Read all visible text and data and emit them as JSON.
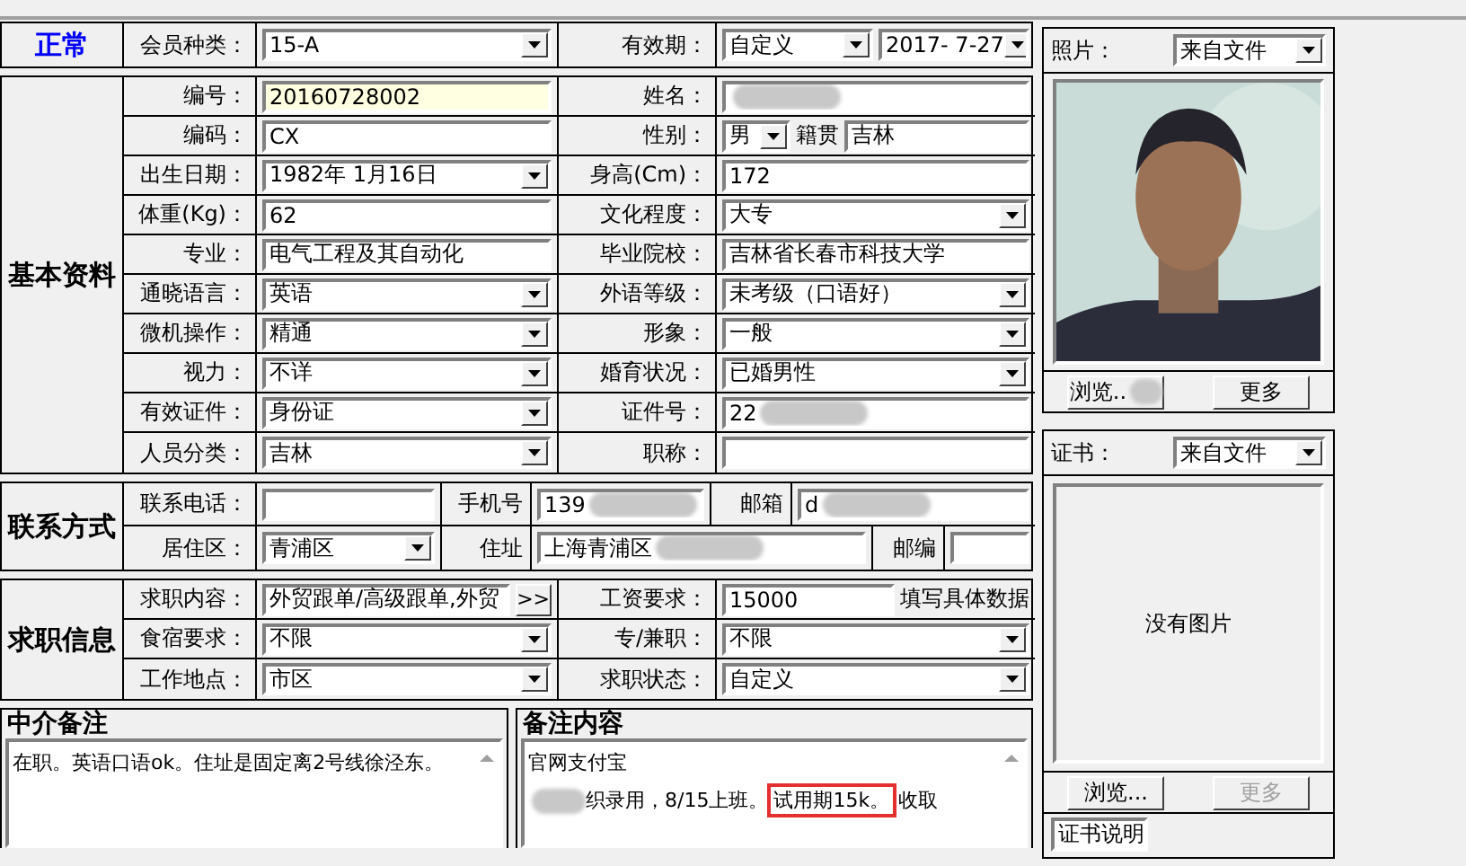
{
  "sections": [
    {
      "kind": "status",
      "title": "正常",
      "rows": [
        {
          "cells": [
            {
              "kind": "label",
              "text": "会员种类："
            },
            {
              "kind": "group",
              "controls": [
                {
                  "kind": "select",
                  "value": "15-A"
                }
              ]
            },
            {
              "kind": "label",
              "text": "有效期："
            },
            {
              "kind": "group",
              "controls": [
                {
                  "kind": "select",
                  "value": "自定义"
                },
                {
                  "kind": "select",
                  "value": "2017- 7-27"
                }
              ]
            }
          ]
        }
      ]
    },
    {
      "kind": "form",
      "title": "基本资料",
      "rows": [
        {
          "cells": [
            {
              "kind": "label",
              "text": "编号："
            },
            {
              "kind": "group",
              "controls": [
                {
                  "kind": "input",
                  "value": "20160728002",
                  "highlighted": true
                }
              ]
            },
            {
              "kind": "label",
              "text": "姓名："
            },
            {
              "kind": "group",
              "controls": [
                {
                  "kind": "input",
                  "highlighted": false,
                  "blurred": true
                }
              ]
            }
          ]
        },
        {
          "cells": [
            {
              "kind": "label",
              "text": "编码："
            },
            {
              "kind": "group",
              "controls": [
                {
                  "kind": "input",
                  "value": "CX",
                  "highlighted": false
                }
              ]
            },
            {
              "kind": "label",
              "text": "性别："
            },
            {
              "kind": "group",
              "controls": [
                {
                  "kind": "select",
                  "value": "男"
                },
                {
                  "kind": "text",
                  "value": "籍贯"
                },
                {
                  "kind": "input",
                  "value": "吉林",
                  "highlighted": false
                }
              ]
            }
          ]
        },
        {
          "cells": [
            {
              "kind": "label",
              "text": "出生日期："
            },
            {
              "kind": "group",
              "controls": [
                {
                  "kind": "select",
                  "value": "1982年 1月16日"
                }
              ]
            },
            {
              "kind": "label",
              "text": "身高(Cm)："
            },
            {
              "kind": "group",
              "controls": [
                {
                  "kind": "input",
                  "value": "172",
                  "highlighted": false
                }
              ]
            }
          ]
        },
        {
          "cells": [
            {
              "kind": "label",
              "text": "体重(Kg)："
            },
            {
              "kind": "group",
              "controls": [
                {
                  "kind": "input",
                  "value": "62",
                  "highlighted": false
                }
              ]
            },
            {
              "kind": "label",
              "text": "文化程度："
            },
            {
              "kind": "group",
              "controls": [
                {
                  "kind": "select",
                  "value": "大专"
                }
              ]
            }
          ]
        },
        {
          "cells": [
            {
              "kind": "label",
              "text": "专业："
            },
            {
              "kind": "group",
              "controls": [
                {
                  "kind": "input",
                  "value": "电气工程及其自动化",
                  "highlighted": false
                }
              ]
            },
            {
              "kind": "label",
              "text": "毕业院校："
            },
            {
              "kind": "group",
              "controls": [
                {
                  "kind": "input",
                  "value": "吉林省长春市科技大学",
                  "highlighted": false
                }
              ]
            }
          ]
        },
        {
          "cells": [
            {
              "kind": "label",
              "text": "通晓语言："
            },
            {
              "kind": "group",
              "controls": [
                {
                  "kind": "select",
                  "value": "英语"
                }
              ]
            },
            {
              "kind": "label",
              "text": "外语等级："
            },
            {
              "kind": "group",
              "controls": [
                {
                  "kind": "select",
                  "value": "未考级（口语好）"
                }
              ]
            }
          ]
        },
        {
          "cells": [
            {
              "kind": "label",
              "text": "微机操作："
            },
            {
              "kind": "group",
              "controls": [
                {
                  "kind": "select",
                  "value": "精通"
                }
              ]
            },
            {
              "kind": "label",
              "text": "形象："
            },
            {
              "kind": "group",
              "controls": [
                {
                  "kind": "select",
                  "value": "一般"
                }
              ]
            }
          ]
        },
        {
          "cells": [
            {
              "kind": "label",
              "text": "视力："
            },
            {
              "kind": "group",
              "controls": [
                {
                  "kind": "select",
                  "value": "不详"
                }
              ]
            },
            {
              "kind": "label",
              "text": "婚育状况："
            },
            {
              "kind": "group",
              "controls": [
                {
                  "kind": "select",
                  "value": "已婚男性"
                }
              ]
            }
          ]
        },
        {
          "cells": [
            {
              "kind": "label",
              "text": "有效证件："
            },
            {
              "kind": "group",
              "controls": [
                {
                  "kind": "select",
                  "value": "身份证"
                }
              ]
            },
            {
              "kind": "label",
              "text": "证件号："
            },
            {
              "kind": "group",
              "controls": [
                {
                  "kind": "input",
                  "value": "22",
                  "highlighted": false,
                  "blurred": true
                }
              ]
            }
          ]
        },
        {
          "cells": [
            {
              "kind": "label",
              "text": "人员分类："
            },
            {
              "kind": "group",
              "controls": [
                {
                  "kind": "select",
                  "value": "吉林"
                }
              ]
            },
            {
              "kind": "label",
              "text": "职称："
            },
            {
              "kind": "group",
              "controls": [
                {
                  "kind": "input",
                  "highlighted": false
                }
              ]
            }
          ]
        }
      ]
    },
    {
      "kind": "contact",
      "title": "联系方式",
      "rows": [
        {
          "cells": [
            {
              "kind": "label",
              "text": "联系电话："
            },
            {
              "kind": "group",
              "controls": [
                {
                  "kind": "input",
                  "highlighted": false
                }
              ]
            },
            {
              "kind": "label",
              "text": "手机号"
            },
            {
              "kind": "group",
              "controls": [
                {
                  "kind": "input",
                  "value": "139",
                  "highlighted": false,
                  "blurred": true
                }
              ]
            },
            {
              "kind": "label",
              "text": "邮箱"
            },
            {
              "kind": "group",
              "controls": [
                {
                  "kind": "input",
                  "value": "d",
                  "highlighted": false,
                  "blurred": true
                }
              ]
            }
          ]
        },
        {
          "cells": [
            {
              "kind": "label",
              "text": "居住区："
            },
            {
              "kind": "group",
              "controls": [
                {
                  "kind": "select",
                  "value": "青浦区"
                }
              ]
            },
            {
              "kind": "label",
              "text": "住址"
            },
            {
              "kind": "group",
              "controls": [
                {
                  "kind": "input",
                  "value": "上海青浦区",
                  "highlighted": false,
                  "blurred": true
                }
              ]
            },
            {
              "kind": "label",
              "text": "邮编"
            },
            {
              "kind": "group",
              "controls": [
                {
                  "kind": "input",
                  "highlighted": false
                }
              ]
            }
          ]
        }
      ]
    },
    {
      "kind": "form",
      "title": "求职信息",
      "rows": [
        {
          "cells": [
            {
              "kind": "label",
              "text": "求职内容："
            },
            {
              "kind": "group",
              "controls": [
                {
                  "kind": "input",
                  "value": "外贸跟单/高级跟单,外贸",
                  "highlighted": false
                },
                {
                  "kind": "button",
                  "value": ">>"
                }
              ]
            },
            {
              "kind": "label",
              "text": "工资要求："
            },
            {
              "kind": "group",
              "controls": [
                {
                  "kind": "input",
                  "value": "15000",
                  "highlighted": false
                },
                {
                  "kind": "text",
                  "value": "填写具体数据"
                }
              ]
            }
          ]
        },
        {
          "cells": [
            {
              "kind": "label",
              "text": "食宿要求："
            },
            {
              "kind": "group",
              "controls": [
                {
                  "kind": "select",
                  "value": "不限"
                }
              ]
            },
            {
              "kind": "label",
              "text": "专/兼职："
            },
            {
              "kind": "group",
              "controls": [
                {
                  "kind": "select",
                  "value": "不限"
                }
              ]
            }
          ]
        },
        {
          "cells": [
            {
              "kind": "label",
              "text": "工作地点："
            },
            {
              "kind": "group",
              "controls": [
                {
                  "kind": "select",
                  "value": "市区"
                }
              ]
            },
            {
              "kind": "label",
              "text": "求职状态："
            },
            {
              "kind": "group",
              "controls": [
                {
                  "kind": "select",
                  "value": "自定义"
                }
              ]
            }
          ]
        }
      ]
    }
  ],
  "agent_note": {
    "title": "中介备注",
    "text": "在职。英语口语ok。住址是固定离2号线徐泾东。"
  },
  "remark": {
    "title": "备注内容",
    "lines": [
      [
        {
          "text": "官网支付宝",
          "boxed": false,
          "blurred": false
        }
      ],
      [
        {
          "text": "织录用，8/15上班。",
          "boxed": false,
          "blurred": true
        },
        {
          "text": "试用期15k。",
          "boxed": true,
          "blurred": false
        },
        {
          "text": "收取",
          "boxed": false,
          "blurred": false
        }
      ]
    ]
  },
  "photo": {
    "label": "照片：",
    "source": "来自文件",
    "buttons": [
      {
        "label": "浏览..",
        "disabled": false,
        "blurred": true
      },
      {
        "label": "更多",
        "disabled": false,
        "blurred": false
      }
    ]
  },
  "certificate": {
    "label": "证书：",
    "source": "来自文件",
    "empty_text": "没有图片",
    "buttons": [
      {
        "label": "浏览...",
        "disabled": false,
        "blurred": false
      },
      {
        "label": "更多",
        "disabled": true,
        "blurred": false
      }
    ],
    "caption": "证书说明"
  }
}
